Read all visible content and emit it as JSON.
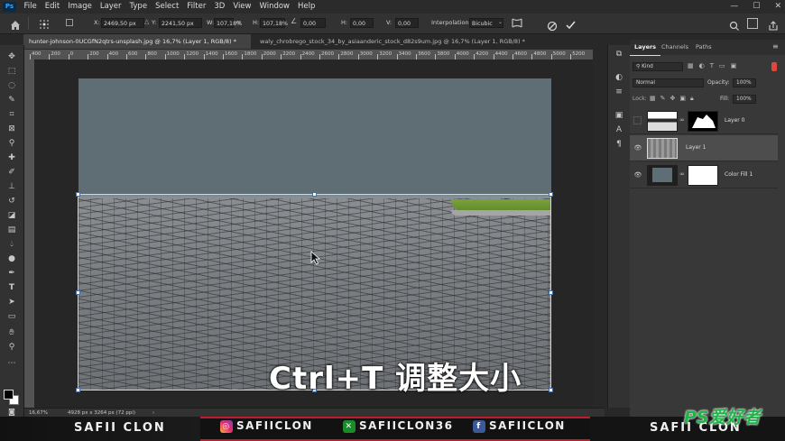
{
  "app": {
    "logo_text": "Ps"
  },
  "menu": [
    "File",
    "Edit",
    "Image",
    "Layer",
    "Type",
    "Select",
    "Filter",
    "3D",
    "View",
    "Window",
    "Help"
  ],
  "window_controls": [
    "—",
    "☐",
    "✕"
  ],
  "options_bar": {
    "home_icon": "home-icon",
    "x_label": "X:",
    "x_value": "2469,50 px",
    "y_label": "Y:",
    "y_value": "2241,50 px",
    "w_label": "W:",
    "w_value": "107,18%",
    "h_label": "H:",
    "h_value": "107,18%",
    "angle_value": "0,00",
    "h2_label": "H:",
    "h2_value": "0,00",
    "v_label": "V:",
    "v_value": "0,00",
    "interpolation_label": "Interpolation:",
    "interpolation_value": "Bicubic",
    "cancel_icon": "cancel-icon",
    "commit_icon": "checkmark-icon"
  },
  "tabs": [
    {
      "label": "hunter-johnson-0UCGfN2qtrs-unsplash.jpg @ 16,7% (Layer 1, RGB/8) *",
      "active": true
    },
    {
      "label": "waly_chrobrego_stock_34_by_asiaanderic_stock_d82s9um.jpg @ 16,7% (Layer 1, RGB/8) *",
      "active": false
    }
  ],
  "ruler_top": [
    "400",
    "200",
    "0",
    "200",
    "400",
    "600",
    "800",
    "1000",
    "1200",
    "1400",
    "1600",
    "1800",
    "2000",
    "2200",
    "2400",
    "2600",
    "2800",
    "3000",
    "3200",
    "3400",
    "3600",
    "3800",
    "4000",
    "4200",
    "4400",
    "4600",
    "4800",
    "5000",
    "5200"
  ],
  "canvas_caption": "Ctrl+T 调整大小",
  "status": {
    "zoom": "16,67%",
    "doc_info": "4928 px x 3264 px (72 ppi)"
  },
  "panels": {
    "tabs": [
      "Layers",
      "Channels",
      "Paths"
    ],
    "kind_label": "Kind",
    "blend_mode": "Normal",
    "opacity_label": "Opacity:",
    "opacity_value": "100%",
    "lock_label": "Lock:",
    "fill_label": "Fill:",
    "fill_value": "100%",
    "layers": [
      {
        "name": "Layer 0",
        "visible": false,
        "selected": false
      },
      {
        "name": "Layer 1",
        "visible": true,
        "selected": true
      },
      {
        "name": "Color Fill 1",
        "visible": true,
        "selected": false
      }
    ]
  },
  "banner": {
    "left_name": "SAFII CLON",
    "instagram": "SAFIICLON",
    "xbox": "SAFIICLON36",
    "facebook": "SAFIICLON",
    "right_name": "SAFII CLON",
    "accent": "#c11c2c"
  },
  "watermark": "PS爱好者"
}
